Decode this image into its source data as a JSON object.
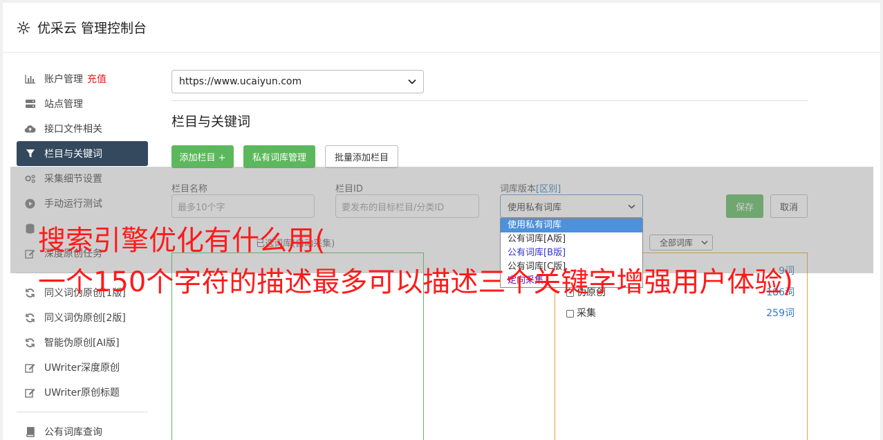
{
  "header": {
    "title": "优采云 管理控制台"
  },
  "sidebar": {
    "items": [
      {
        "label": "账户管理",
        "extra": "充值",
        "icon": "bar-chart-icon"
      },
      {
        "label": "站点管理",
        "icon": "server-icon"
      },
      {
        "label": "接口文件相关",
        "icon": "cloud-upload-icon"
      },
      {
        "label": "栏目与关键词",
        "icon": "filter-icon",
        "active": true
      },
      {
        "label": "采集细节设置",
        "icon": "gears-icon"
      },
      {
        "label": "手动运行测试",
        "icon": "play-circle-icon"
      },
      {
        "label": "",
        "icon": "database-icon"
      },
      {
        "label": "深度原创任务",
        "icon": "edit-icon"
      }
    ],
    "items2": [
      {
        "label": "同义词伪原创[1版]",
        "icon": "refresh-icon"
      },
      {
        "label": "同义词伪原创[2版]",
        "icon": "refresh-icon"
      },
      {
        "label": "智能伪原创[AI版]",
        "icon": "refresh-icon"
      },
      {
        "label": "UWriter深度原创",
        "icon": "edit-icon"
      },
      {
        "label": "UWriter原创标题",
        "icon": "edit-icon"
      }
    ],
    "items3": [
      {
        "label": "公有词库查询",
        "icon": "book-icon"
      }
    ]
  },
  "site_select": {
    "value": "https://www.ucaiyun.com"
  },
  "section": {
    "title": "栏目与关键词"
  },
  "buttons": {
    "add_column": "添加栏目 +",
    "private_lib": "私有词库管理",
    "batch_add": "批量添加栏目",
    "save": "保存",
    "cancel": "取消"
  },
  "form": {
    "name_label": "栏目名称",
    "name_placeholder": "最多10个字",
    "id_label": "栏目ID",
    "id_placeholder": "要发布的目标栏目/分类ID",
    "lib_label": "词库版本",
    "lib_label_link": "[区别]",
    "lib_value": "使用私有词库",
    "lib_options": [
      "使用私有词库",
      "公有词库[A版]",
      "公有词库[B版]",
      "公有词库[C版]",
      "定向采集"
    ],
    "hint": "已选词库(自动采集)",
    "filter_value": "全部词库"
  },
  "libraries": [
    {
      "name": "",
      "count": "9词"
    },
    {
      "name": "伪原创",
      "count": "186词"
    },
    {
      "name": "采集",
      "count": "259词"
    }
  ],
  "watermark": {
    "line1": "搜索引擎优化有什么用(",
    "line2": "一个150个字符的描述最多可以描述三个关键字增强用户体验)"
  },
  "colors": {
    "accent_green": "#5cb85c",
    "sidebar_active": "#34495e",
    "link_blue": "#337ab7",
    "watermark_red": "#ff1a1a"
  }
}
